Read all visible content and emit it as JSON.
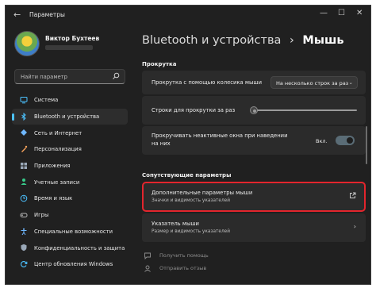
{
  "window": {
    "title": "Параметры",
    "controls": {
      "minimize": "—",
      "maximize": "☐",
      "close": "✕"
    },
    "back": "←"
  },
  "profile": {
    "name": "Виктор Бухтеев"
  },
  "search": {
    "placeholder": "Найти параметр"
  },
  "sidebar": {
    "items": [
      {
        "label": "Система",
        "icon": "system-icon",
        "color": "#4cc2ff"
      },
      {
        "label": "Bluetooth и устройства",
        "icon": "bluetooth-icon",
        "color": "#4cc2ff",
        "active": true
      },
      {
        "label": "Сеть и Интернет",
        "icon": "network-icon",
        "color": "#6fb7ff"
      },
      {
        "label": "Персонализация",
        "icon": "personalization-icon",
        "color": "#f7a35c"
      },
      {
        "label": "Приложения",
        "icon": "apps-icon",
        "color": "#9aa8b8"
      },
      {
        "label": "Учетные записи",
        "icon": "accounts-icon",
        "color": "#38c98a"
      },
      {
        "label": "Время и язык",
        "icon": "time-language-icon",
        "color": "#4cc2ff"
      },
      {
        "label": "Игры",
        "icon": "gaming-icon",
        "color": "#b7b7b7"
      },
      {
        "label": "Специальные возможности",
        "icon": "accessibility-icon",
        "color": "#6fb7ff"
      },
      {
        "label": "Конфиденциальность и защита",
        "icon": "privacy-icon",
        "color": "#9aa8b8"
      },
      {
        "label": "Центр обновления Windows",
        "icon": "windows-update-icon",
        "color": "#4cc2ff"
      }
    ]
  },
  "breadcrumb": {
    "parent": "Bluetooth и устройства",
    "separator": "›",
    "current": "Мышь"
  },
  "scroll_section": {
    "heading": "Прокрутка",
    "wheel": {
      "label": "Прокрутка с помощью колесика мыши",
      "value": "На несколько строк за раз"
    },
    "lines": {
      "label": "Строки для прокрутки за раз",
      "level": 0.0
    },
    "inactive": {
      "label_line1": "Прокручивать неактивные окна при наведении",
      "label_line2": "на них",
      "state": "Вкл."
    }
  },
  "related": {
    "heading": "Сопутствующие параметры",
    "items": [
      {
        "title": "Дополнительные параметры мыши",
        "subtitle": "Значки и видимость указателей",
        "icon": "external-link-icon"
      },
      {
        "title": "Указатель мыши",
        "subtitle": "Размер и видимость указателей",
        "icon": "chevron-right-icon"
      }
    ]
  },
  "help": {
    "get_help": "Получить помощь",
    "feedback": "Отправить отзыв"
  },
  "colors": {
    "accent": "#4cc2ff",
    "highlight": "#e3252d",
    "window_bg": "#202020",
    "card_bg": "#2b2b2b"
  }
}
